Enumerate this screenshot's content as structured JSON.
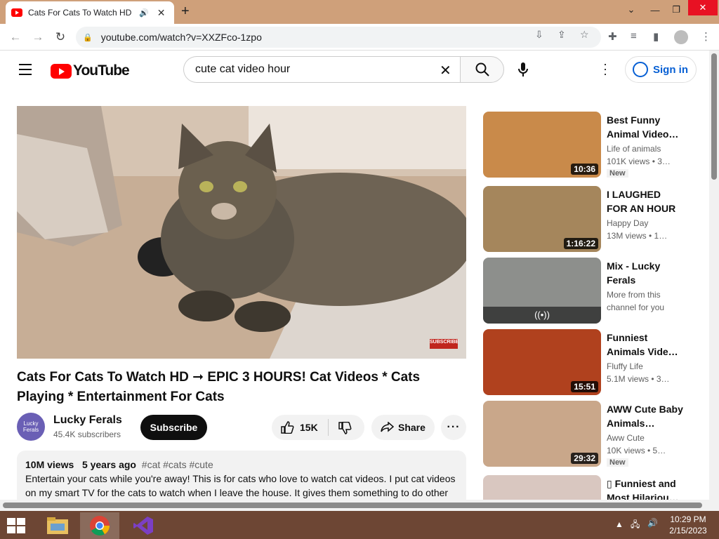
{
  "browser": {
    "tab_title": "Cats For Cats To Watch HD ~",
    "url": "youtube.com/watch?v=XXZFco-1zpo"
  },
  "youtube": {
    "logo_text": "YouTube",
    "search_query": "cute cat video hour",
    "signin_label": "Sign in"
  },
  "video": {
    "title": "Cats For Cats To Watch HD ➞ EPIC 3 HOURS! Cat Videos * Cats Playing * Entertainment For Cats",
    "overlay_text": "SUBSCRIBE",
    "channel": {
      "avatar_text": "Lucky Ferals",
      "name": "Lucky Ferals",
      "subscribers": "45.4K subscribers"
    },
    "subscribe_label": "Subscribe",
    "likes": "15K",
    "share_label": "Share",
    "more_label": "···",
    "description": {
      "views": "10M views",
      "age": "5 years ago",
      "tags": "#cat #cats #cute",
      "text": "Entertain your cats while you're away! This is for cats who love to watch cat videos. I put cat videos on my smart TV for the cats to watch when I leave the house. It gives them something to do other"
    }
  },
  "recommendations": [
    {
      "title": "Best Funny Animal Video…",
      "channel": "Life of animals",
      "views": "101K views • 3…",
      "duration": "10:36",
      "badge": "New",
      "thumb_color": "#c98a4a"
    },
    {
      "title": "I LAUGHED FOR AN HOUR😹…",
      "channel": "Happy Day",
      "views": "13M views • 1…",
      "duration": "1:16:22",
      "badge": "",
      "thumb_color": "#a5865c"
    },
    {
      "title": "Mix - Lucky Ferals",
      "channel": "More from this",
      "views": "channel for you",
      "duration": "",
      "mix_icon": "((•))",
      "badge": "",
      "thumb_color": "#8d8f8c"
    },
    {
      "title": "Funniest Animals Vide…",
      "channel": "Fluffy Life",
      "views": "5.1M views • 3…",
      "duration": "15:51",
      "badge": "",
      "thumb_color": "#b0411e"
    },
    {
      "title": "AWW Cute Baby Animals…",
      "channel": "Aww Cute",
      "views": "10K views • 5…",
      "duration": "29:32",
      "badge": "New",
      "thumb_color": "#c9a78a"
    },
    {
      "title": "▯ Funniest and Most Hilariou…",
      "channel": "",
      "views": "",
      "duration": "",
      "badge": "",
      "thumb_color": "#d9c7c0"
    }
  ],
  "taskbar": {
    "time": "10:29 PM",
    "date": "2/15/2023"
  },
  "colors": {
    "tab_strip": "#cfa07a",
    "youtube_red": "#ff0000",
    "signin_blue": "#065fd4",
    "taskbar": "#6d4634"
  }
}
